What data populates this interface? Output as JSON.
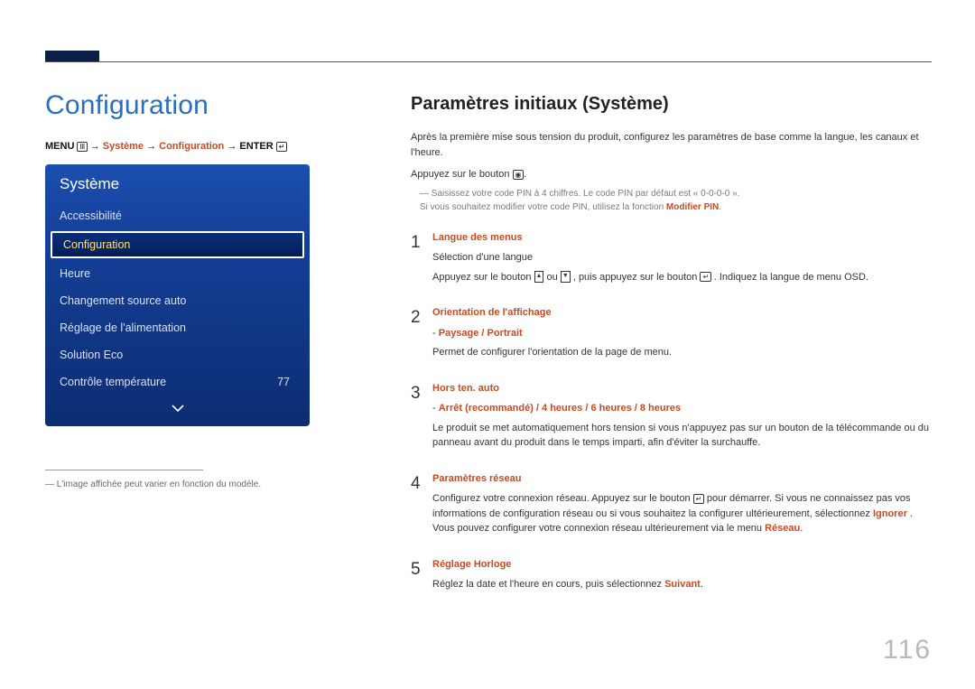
{
  "page_number": "116",
  "left": {
    "title": "Configuration",
    "breadcrumb": {
      "menu": "MENU",
      "systeme": "Système",
      "config": "Configuration",
      "enter": "ENTER"
    },
    "osd": {
      "title": "Système",
      "items": [
        "Accessibilité",
        "Configuration",
        "Heure",
        "Changement source auto",
        "Réglage de l'alimentation",
        "Solution Eco",
        "Contrôle température"
      ],
      "temp_value": "77"
    },
    "footnote": "L'image affichée peut varier en fonction du modèle."
  },
  "right": {
    "heading": "Paramètres initiaux (Système)",
    "intro": "Après la première mise sous tension du produit, configurez les paramètres de base comme la langue, les canaux et l'heure.",
    "press_button": "Appuyez sur le bouton ",
    "note_pin": "Saisissez votre code PIN à 4 chiffres. Le code PIN par défaut est « 0-0-0-0 ».",
    "note_modify_prefix": "Si vous souhaitez modifier votre code PIN, utilisez la fonction ",
    "note_modify_hl": "Modifier PIN",
    "steps": [
      {
        "num": "1",
        "title": "Langue des menus",
        "line1": "Sélection d'une langue",
        "line2a": "Appuyez sur le bouton ",
        "line2b": " ou ",
        "line2c": ", puis appuyez sur le bouton ",
        "line2d": ". Indiquez la langue de menu OSD."
      },
      {
        "num": "2",
        "title": "Orientation de l'affichage",
        "options": "Paysage / Portrait",
        "desc": "Permet de configurer l'orientation de la page de menu."
      },
      {
        "num": "3",
        "title": "Hors ten. auto",
        "options": "Arrêt (recommandé) / 4 heures / 6 heures / 8 heures",
        "desc": "Le produit se met automatiquement hors tension si vous n'appuyez pas sur un bouton de la télécommande ou du panneau avant du produit dans le temps imparti, afin d'éviter la surchauffe."
      },
      {
        "num": "4",
        "title": "Paramètres réseau",
        "desc_a": "Configurez votre connexion réseau. Appuyez sur le bouton ",
        "desc_b": " pour démarrer. Si vous ne connaissez pas vos informations de configuration réseau ou si vous souhaitez la configurer ultérieurement, sélectionnez ",
        "hl_ignorer": "Ignorer",
        "desc_c": ". Vous pouvez configurer votre connexion réseau ultérieurement via le menu ",
        "hl_reseau": "Réseau"
      },
      {
        "num": "5",
        "title": "Réglage Horloge",
        "desc": "Réglez la date et l'heure en cours, puis sélectionnez ",
        "hl": "Suivant"
      }
    ]
  }
}
